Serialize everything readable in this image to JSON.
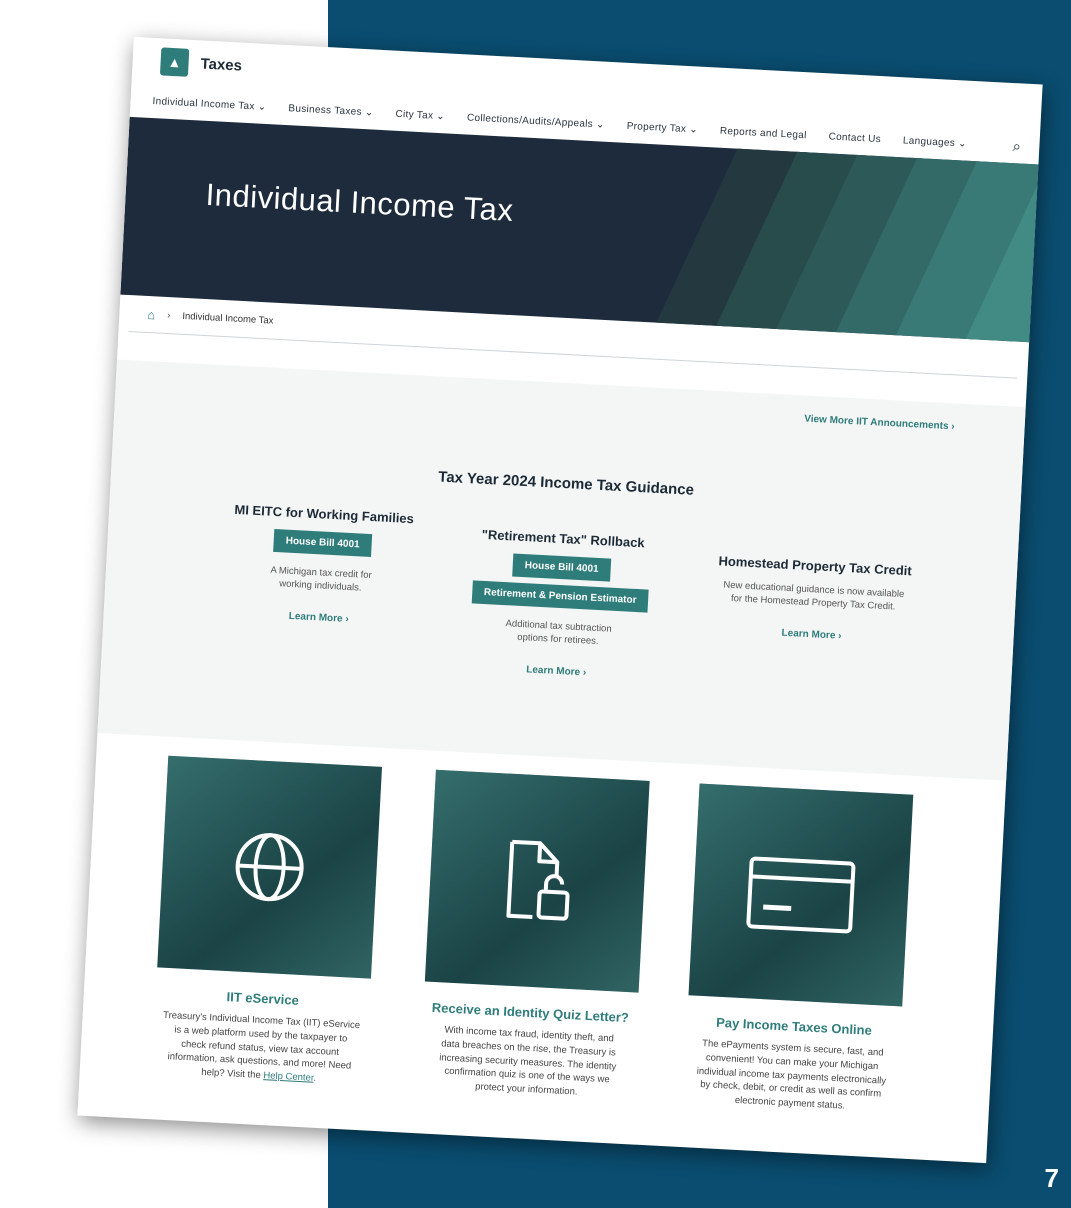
{
  "slide": {
    "page_number": "7"
  },
  "header": {
    "brand": "Taxes"
  },
  "nav": {
    "items": [
      "Individual Income Tax ⌄",
      "Business Taxes ⌄",
      "City Tax ⌄",
      "Collections/Audits/Appeals ⌄",
      "Property Tax ⌄",
      "Reports and Legal",
      "Contact Us",
      "Languages ⌄"
    ],
    "search_icon": "⌕"
  },
  "hero": {
    "title": "Individual Income Tax"
  },
  "breadcrumb": {
    "home_icon": "⌂",
    "separator": "›",
    "current": "Individual Income Tax"
  },
  "announcements": {
    "view_more": "View More IIT Announcements ›",
    "guidance_title": "Tax Year 2024 Income Tax Guidance",
    "columns": [
      {
        "title": "MI EITC for Working Families",
        "buttons": [
          "House Bill 4001"
        ],
        "desc_line1": "A Michigan tax credit for",
        "desc_line2": "working individuals.",
        "learn": "Learn More ›"
      },
      {
        "title": "\"Retirement Tax\" Rollback",
        "buttons": [
          "House Bill 4001",
          "Retirement & Pension Estimator"
        ],
        "desc_line1": "Additional tax subtraction",
        "desc_line2": "options for retirees.",
        "learn": "Learn More ›"
      },
      {
        "title": "Homestead Property Tax Credit",
        "buttons": [],
        "desc_line1": "New educational guidance is now available",
        "desc_line2": "for the Homestead Property Tax Credit.",
        "learn": "Learn More ›"
      }
    ]
  },
  "cards": [
    {
      "icon": "globe-icon",
      "title": "IIT eService",
      "l1": "Treasury's Individual Income Tax (IIT) eService",
      "l2": "is a web platform used by the taxpayer to",
      "l3": "check refund status, view tax account",
      "l4": "information, ask questions, and more! Need",
      "l5_pre": "help? Visit the ",
      "l5_link": "Help Center",
      "l5_post": "."
    },
    {
      "icon": "unlock-document-icon",
      "title": "Receive an Identity Quiz Letter?",
      "l1": "With income tax fraud, identity theft, and",
      "l2": "data breaches on the rise, the Treasury is",
      "l3": "increasing security measures. The identity",
      "l4": "confirmation quiz is one of the ways we",
      "l5": "protect your information."
    },
    {
      "icon": "credit-card-icon",
      "title": "Pay Income Taxes Online",
      "l1": "The ePayments system is secure, fast, and",
      "l2": "convenient! You can make your Michigan",
      "l3": "individual income tax payments electronically",
      "l4": "by check, debit, or credit as well as confirm",
      "l5": "electronic payment status."
    }
  ]
}
